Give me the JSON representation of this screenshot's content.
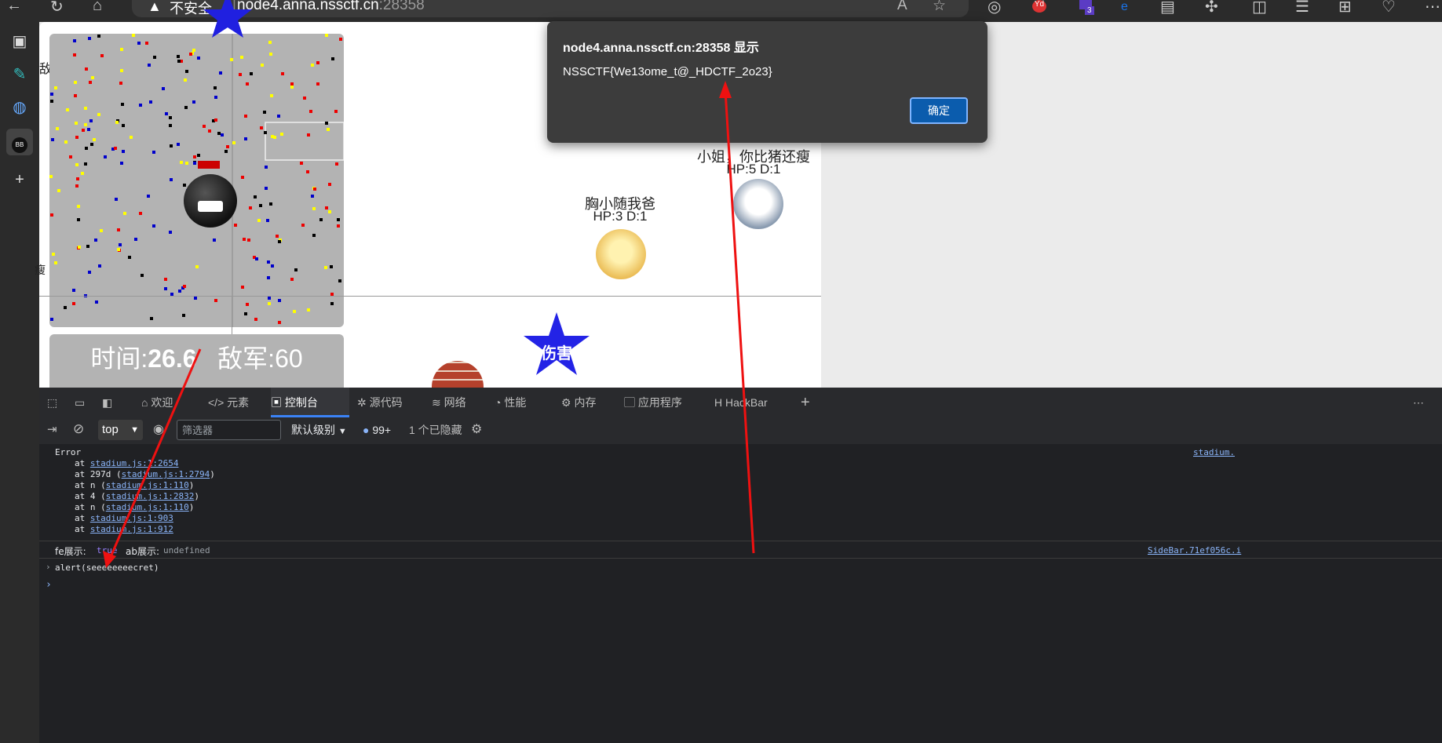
{
  "browser": {
    "address_warning": "不安全",
    "address_host": "node4.anna.nssctf.cn",
    "address_port": ":28358",
    "tab_badge": "3"
  },
  "game": {
    "top_left_label": "敌畀",
    "side_label": "瘦",
    "time_label": "时间:",
    "time_value": "26.6",
    "enemy_label": "敌军:",
    "enemy_value": "60",
    "star_text": "伤害",
    "players": [
      {
        "name": "小姐，你比猪还瘦",
        "hp": "HP:5 D:1"
      },
      {
        "name": "胸小随我爸",
        "hp": "HP:3 D:1"
      }
    ]
  },
  "dialog": {
    "title": "node4.anna.nssctf.cn:28358 显示",
    "message": "NSSCTF{We13ome_t@_HDCTF_2o23}",
    "ok_label": "确定"
  },
  "devtools": {
    "tabs": [
      {
        "label": "欢迎",
        "icon": "home-icon"
      },
      {
        "label": "元素",
        "icon": "code-icon"
      },
      {
        "label": "控制台",
        "icon": "console-icon"
      },
      {
        "label": "源代码",
        "icon": "bug-icon"
      },
      {
        "label": "网络",
        "icon": "wifi-icon"
      },
      {
        "label": "性能",
        "icon": "gauge-icon"
      },
      {
        "label": "内存",
        "icon": "gear-chip-icon"
      },
      {
        "label": "应用程序",
        "icon": "app-icon"
      },
      {
        "label": "HackBar",
        "icon": "hackbar-icon"
      }
    ],
    "context": "top",
    "filter_placeholder": "筛选器",
    "level": "默认级别",
    "message_count": "99+",
    "hidden_count": "1 个已隐藏"
  },
  "console": {
    "error_title": "Error",
    "error_source": "stadium.",
    "stack": [
      {
        "prefix": "at ",
        "link": "stadium.js:1:2654",
        "suffix": ""
      },
      {
        "prefix": "at 297d (",
        "link": "stadium.js:1:2794",
        "suffix": ")"
      },
      {
        "prefix": "at n (",
        "link": "stadium.js:1:110",
        "suffix": ")"
      },
      {
        "prefix": "at 4 (",
        "link": "stadium.js:1:2832",
        "suffix": ")"
      },
      {
        "prefix": "at n (",
        "link": "stadium.js:1:110",
        "suffix": ")"
      },
      {
        "prefix": "at ",
        "link": "stadium.js:1:903",
        "suffix": ""
      },
      {
        "prefix": "at ",
        "link": "stadium.js:1:912",
        "suffix": ""
      }
    ],
    "log_fe_label": "fe展示:",
    "log_fe_value": "true",
    "log_ab_label": "ab展示:",
    "log_ab_value": "undefined",
    "log_source": "SideBar.71ef056c.i",
    "command": "alert(seeeeeeeecret)"
  }
}
